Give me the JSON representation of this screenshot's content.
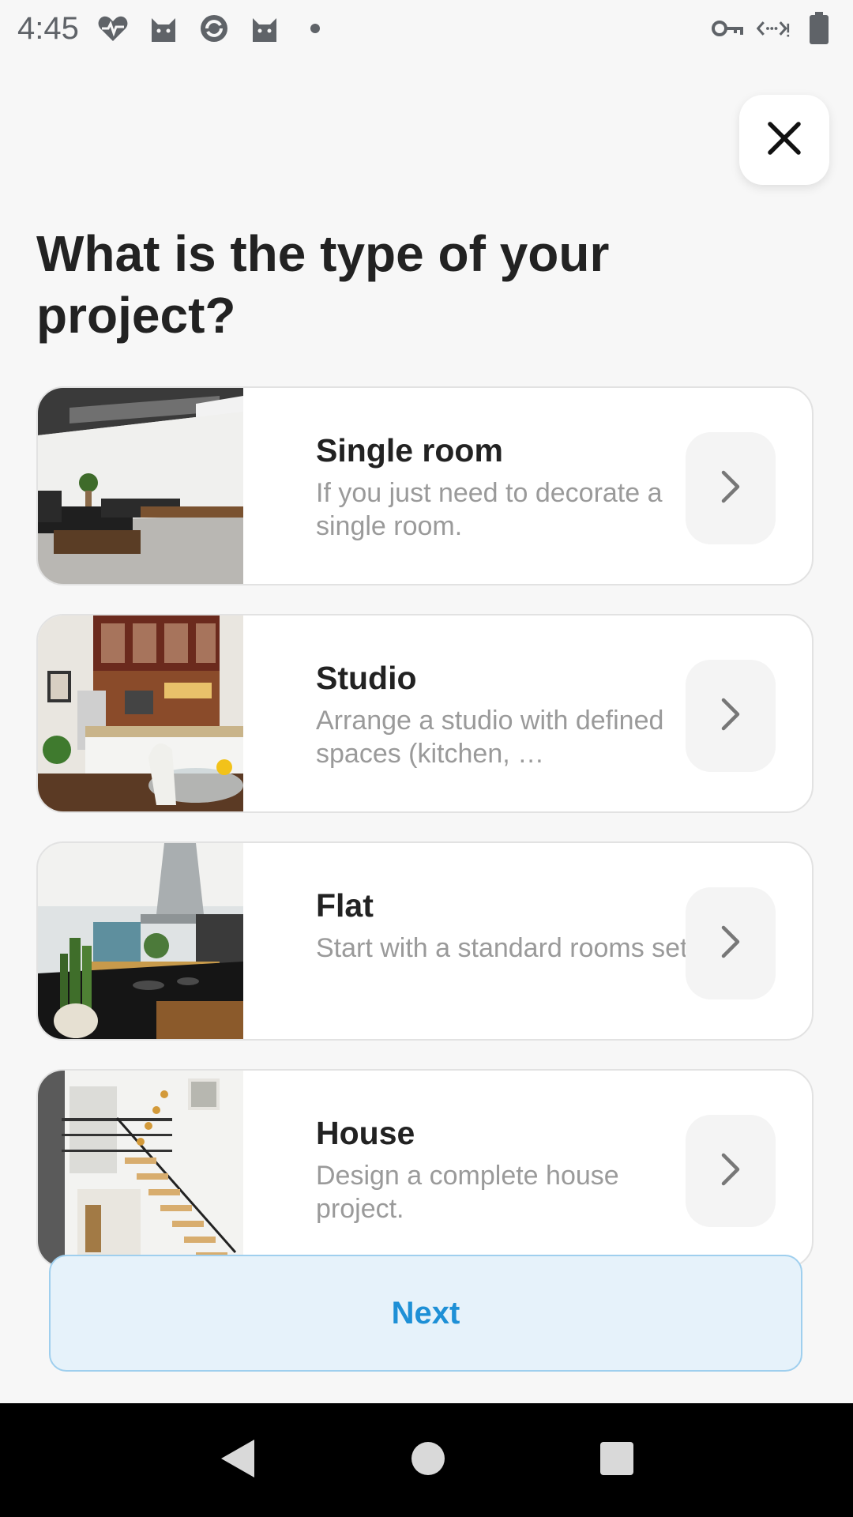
{
  "status_bar": {
    "time": "4:45",
    "icons": [
      "heart-pulse-icon",
      "cat-icon",
      "sync-icon",
      "cat-icon",
      "dot-icon",
      "vpn-key-icon",
      "data-saver-icon",
      "battery-icon"
    ]
  },
  "page": {
    "title": "What is the type of your project?"
  },
  "options": [
    {
      "title": "Single room",
      "description": "If you just need to decorate a single room."
    },
    {
      "title": "Studio",
      "description": "Arrange a studio with defined spaces (kitchen, …"
    },
    {
      "title": "Flat",
      "description": "Start with a standard rooms set."
    },
    {
      "title": "House",
      "description": "Design a complete house project."
    }
  ],
  "next_button": {
    "label": "Next"
  },
  "colors": {
    "accent": "#1e90d6",
    "accent_bg": "#e6f2fa",
    "background": "#f7f7f7"
  },
  "nav_bar": {
    "buttons": [
      "back-icon",
      "home-icon",
      "recents-icon"
    ]
  }
}
